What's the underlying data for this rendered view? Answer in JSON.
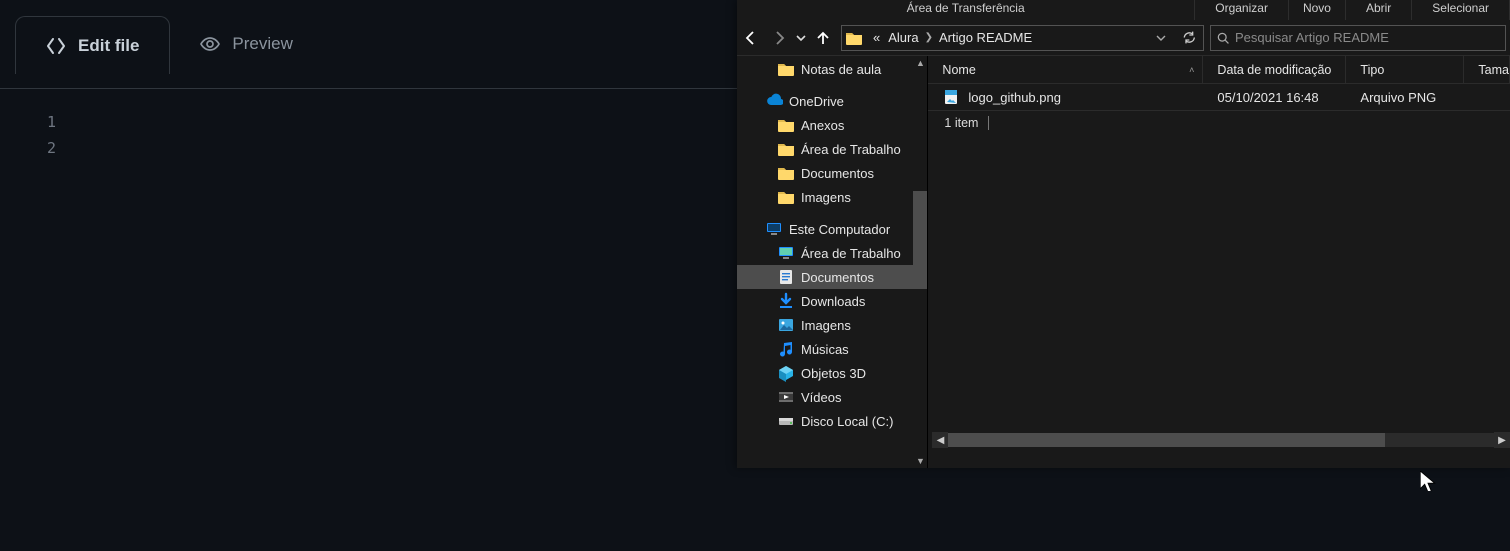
{
  "editor": {
    "tabs": {
      "edit": "Edit file",
      "preview": "Preview"
    },
    "lines": [
      "1",
      "2"
    ]
  },
  "explorer": {
    "ribbon": {
      "g1": "Área de Transferência",
      "g2": "Organizar",
      "g3": "Novo",
      "g4": "Abrir",
      "g5": "Selecionar"
    },
    "breadcrumb": {
      "pre": "«",
      "a": "Alura",
      "b": "Artigo README"
    },
    "search_placeholder": "Pesquisar Artigo README",
    "nav": {
      "notas": "Notas de aula",
      "onedrive": "OneDrive",
      "anexos": "Anexos",
      "area_trab_od": "Área de Trabalho",
      "documentos_od": "Documentos",
      "imagens_od": "Imagens",
      "este_pc": "Este Computador",
      "area_trab_pc": "Área de Trabalho",
      "documentos_pc": "Documentos",
      "downloads": "Downloads",
      "imagens_pc": "Imagens",
      "musicas": "Músicas",
      "obj3d": "Objetos 3D",
      "videos": "Vídeos",
      "disco_c": "Disco Local (C:)"
    },
    "columns": {
      "name": "Nome",
      "date": "Data de modificação",
      "type": "Tipo",
      "size": "Tama"
    },
    "files": [
      {
        "name": "logo_github.png",
        "date": "05/10/2021 16:48",
        "type": "Arquivo PNG"
      }
    ],
    "status": "1 item"
  }
}
